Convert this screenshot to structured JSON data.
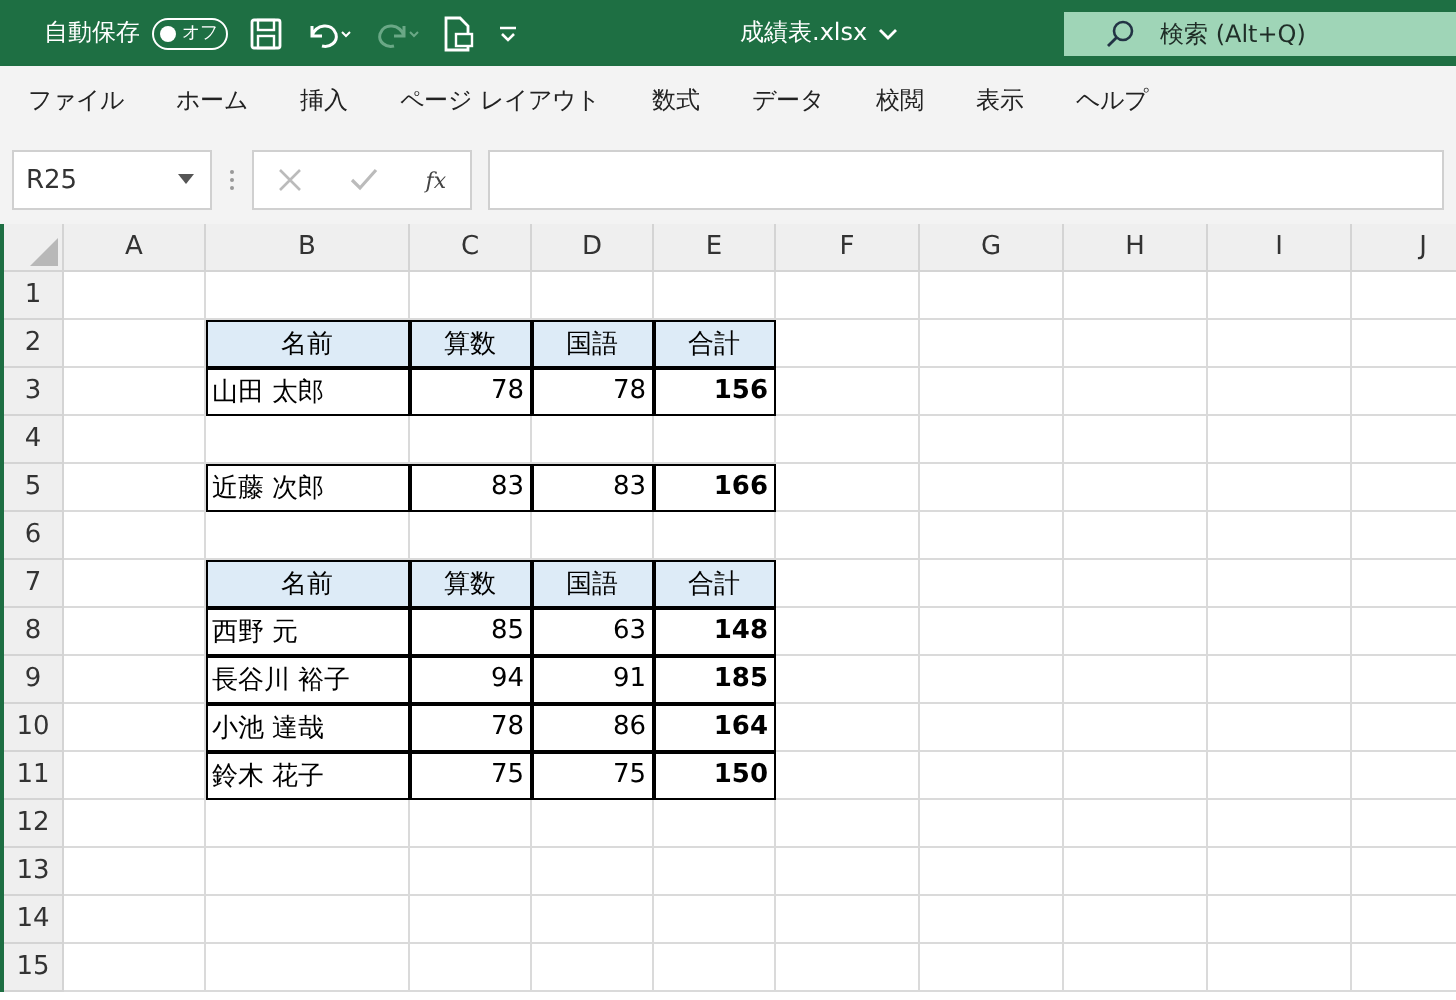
{
  "title_bar": {
    "autosave_label": "自動保存",
    "autosave_toggle": {
      "label": "オフ",
      "on": false
    },
    "file_name": "成績表.xlsx",
    "search": {
      "placeholder": "検索 (Alt+Q)"
    }
  },
  "ribbon_tabs": [
    {
      "label": "ファイル"
    },
    {
      "label": "ホーム"
    },
    {
      "label": "挿入"
    },
    {
      "label": "ページ レイアウト"
    },
    {
      "label": "数式"
    },
    {
      "label": "データ"
    },
    {
      "label": "校閲"
    },
    {
      "label": "表示"
    },
    {
      "label": "ヘルプ"
    }
  ],
  "formula_bar": {
    "name_box": "R25",
    "fx": "fx"
  },
  "sheet": {
    "columns": [
      "A",
      "B",
      "C",
      "D",
      "E",
      "F",
      "G",
      "H",
      "I",
      "J"
    ],
    "rows": [
      {
        "number": "1"
      },
      {
        "number": "2",
        "cells": [
          {
            "kind": "header",
            "text": "名前"
          },
          {
            "kind": "header",
            "text": "算数"
          },
          {
            "kind": "header",
            "text": "国語"
          },
          {
            "kind": "header",
            "text": "合計"
          }
        ]
      },
      {
        "number": "3",
        "cells": [
          {
            "kind": "text",
            "text": "山田 太郎"
          },
          {
            "kind": "number",
            "text": "78"
          },
          {
            "kind": "number",
            "text": "78"
          },
          {
            "kind": "total",
            "text": "156"
          }
        ]
      },
      {
        "number": "4"
      },
      {
        "number": "5",
        "cells": [
          {
            "kind": "text",
            "text": "近藤 次郎"
          },
          {
            "kind": "number",
            "text": "83"
          },
          {
            "kind": "number",
            "text": "83"
          },
          {
            "kind": "total",
            "text": "166"
          }
        ]
      },
      {
        "number": "6"
      },
      {
        "number": "7",
        "cells": [
          {
            "kind": "header",
            "text": "名前"
          },
          {
            "kind": "header",
            "text": "算数"
          },
          {
            "kind": "header",
            "text": "国語"
          },
          {
            "kind": "header",
            "text": "合計"
          }
        ]
      },
      {
        "number": "8",
        "cells": [
          {
            "kind": "text",
            "text": "西野 元"
          },
          {
            "kind": "number",
            "text": "85"
          },
          {
            "kind": "number",
            "text": "63"
          },
          {
            "kind": "total",
            "text": "148"
          }
        ]
      },
      {
        "number": "9",
        "cells": [
          {
            "kind": "text",
            "text": "長谷川 裕子"
          },
          {
            "kind": "number",
            "text": "94"
          },
          {
            "kind": "number",
            "text": "91"
          },
          {
            "kind": "total",
            "text": "185"
          }
        ]
      },
      {
        "number": "10",
        "cells": [
          {
            "kind": "text",
            "text": "小池 達哉"
          },
          {
            "kind": "number",
            "text": "78"
          },
          {
            "kind": "number",
            "text": "86"
          },
          {
            "kind": "total",
            "text": "164"
          }
        ]
      },
      {
        "number": "11",
        "cells": [
          {
            "kind": "text",
            "text": "鈴木 花子"
          },
          {
            "kind": "number",
            "text": "75"
          },
          {
            "kind": "number",
            "text": "75"
          },
          {
            "kind": "total",
            "text": "150"
          }
        ]
      },
      {
        "number": "12"
      },
      {
        "number": "13"
      },
      {
        "number": "14"
      },
      {
        "number": "15"
      }
    ]
  }
}
